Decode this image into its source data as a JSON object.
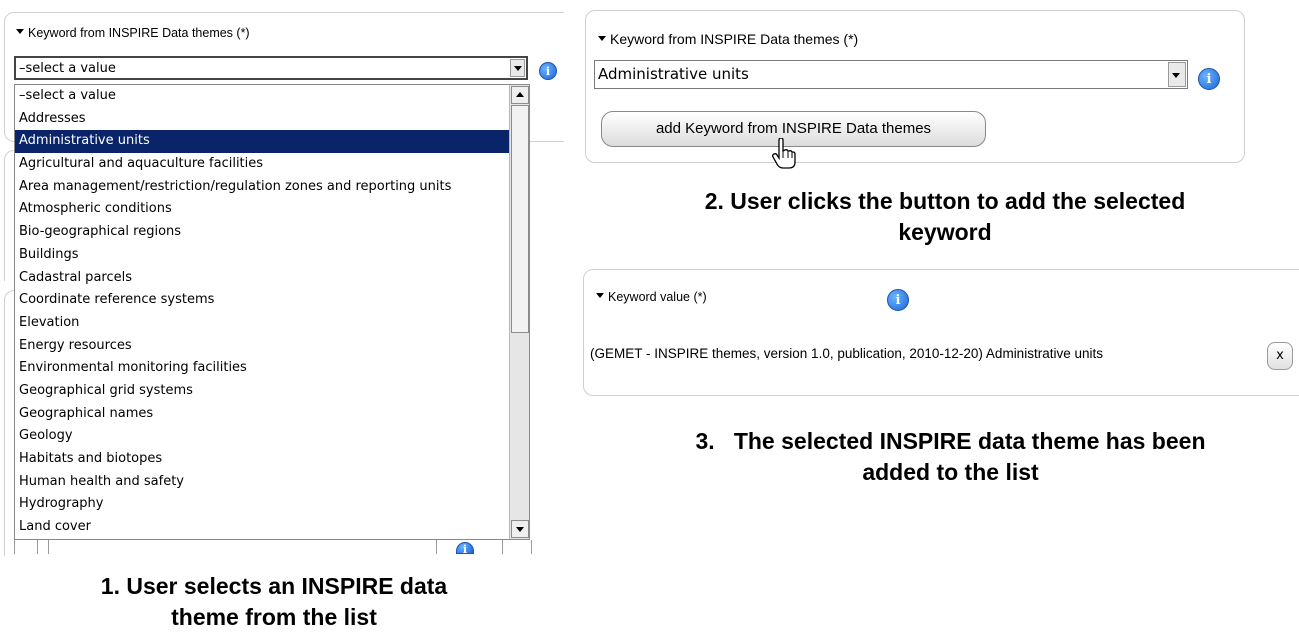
{
  "step1": {
    "field_label": "Keyword from INSPIRE Data themes (*)",
    "select_value": "–select a value",
    "options": [
      "–select a value",
      "Addresses",
      "Administrative units",
      "Agricultural and aquaculture facilities",
      "Area management/restriction/regulation zones and reporting units",
      "Atmospheric conditions",
      "Bio-geographical regions",
      "Buildings",
      "Cadastral parcels",
      "Coordinate reference systems",
      "Elevation",
      "Energy resources",
      "Environmental monitoring facilities",
      "Geographical grid systems",
      "Geographical names",
      "Geology",
      "Habitats and biotopes",
      "Human health and safety",
      "Hydrography",
      "Land cover"
    ],
    "highlighted_index": 2,
    "caption_line1": "1. User selects an INSPIRE data",
    "caption_line2": "theme from the list"
  },
  "step2": {
    "field_label": "Keyword from INSPIRE Data themes (*)",
    "select_value": "Administrative units",
    "button_label": "add Keyword from INSPIRE Data themes",
    "caption_line1": "2. User clicks the button to add the selected",
    "caption_line2": "keyword"
  },
  "step3": {
    "field_label": "Keyword value (*)",
    "keyword_text": "(GEMET - INSPIRE themes, version 1.0, publication, 2010-12-20) Administrative units",
    "remove_label": "x",
    "caption_line1": "3.   The selected INSPIRE data theme has been",
    "caption_line2": "added to the list"
  },
  "icons": {
    "info": "info-icon",
    "expand": "triangle-down-icon",
    "cursor": "hand-pointer-icon"
  },
  "colors": {
    "highlight": "#0a246a",
    "info_blue": "#1a64d6",
    "panel_border": "#cfcfcf"
  }
}
